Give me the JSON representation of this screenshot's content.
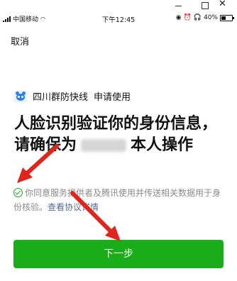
{
  "status_bar": {
    "carrier": "中国移动",
    "time": "下午12:45",
    "battery": "40%",
    "battery_level": 0.4
  },
  "nav": {
    "cancel_label": "取消"
  },
  "app": {
    "name": "四川群防快线",
    "action": "申请使用"
  },
  "headline": {
    "line1": "人脸识别验证你的身份信息，",
    "line2_prefix": "请确保为",
    "line2_suffix": "本人操作"
  },
  "consent": {
    "text": "你同意服务提供者及腾讯使用并传送相关数据用于身份核验。",
    "link": "查看协议详情"
  },
  "primary_button": {
    "label": "下一步"
  },
  "colors": {
    "accent": "#1aad19",
    "link": "#576b95",
    "annotation": "#e0251d"
  }
}
